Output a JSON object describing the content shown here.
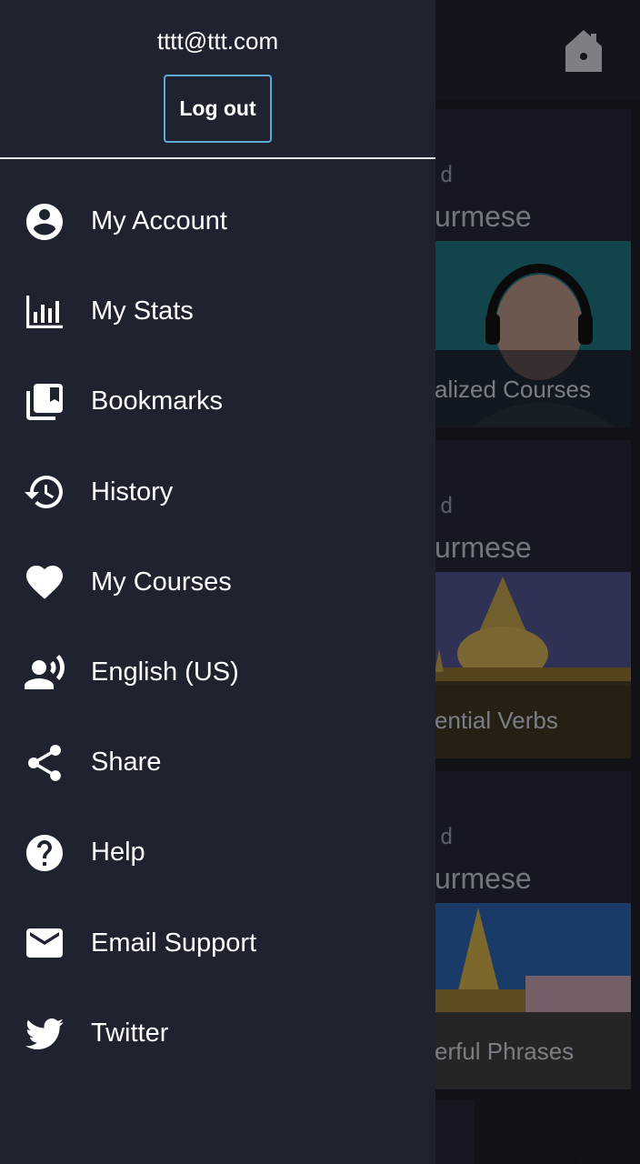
{
  "drawer": {
    "user_email": "tttt@ttt.com",
    "logout_label": "Log out",
    "items": [
      {
        "label": "My Account",
        "icon": "account-circle-icon"
      },
      {
        "label": "My Stats",
        "icon": "stats-bar-icon"
      },
      {
        "label": "Bookmarks",
        "icon": "bookmarks-icon"
      },
      {
        "label": "History",
        "icon": "history-icon"
      },
      {
        "label": "My Courses",
        "icon": "heart-icon"
      },
      {
        "label": "English (US)",
        "icon": "voice-person-icon"
      },
      {
        "label": "Share",
        "icon": "share-icon"
      },
      {
        "label": "Help",
        "icon": "help-icon"
      },
      {
        "label": "Email Support",
        "icon": "email-icon"
      },
      {
        "label": "Twitter",
        "icon": "twitter-icon"
      }
    ]
  },
  "background": {
    "home_icon": "home-icon",
    "cards": [
      {
        "level": "d",
        "language": "urmese",
        "course": "alized Courses"
      },
      {
        "level": "d",
        "language": "urmese",
        "course": "ential Verbs"
      },
      {
        "level": "d",
        "language": "urmese",
        "course": "erful Phrases"
      }
    ]
  },
  "colors": {
    "drawer_bg": "#1f2330",
    "logout_border": "#5ea9d6",
    "text": "#ffffff"
  }
}
